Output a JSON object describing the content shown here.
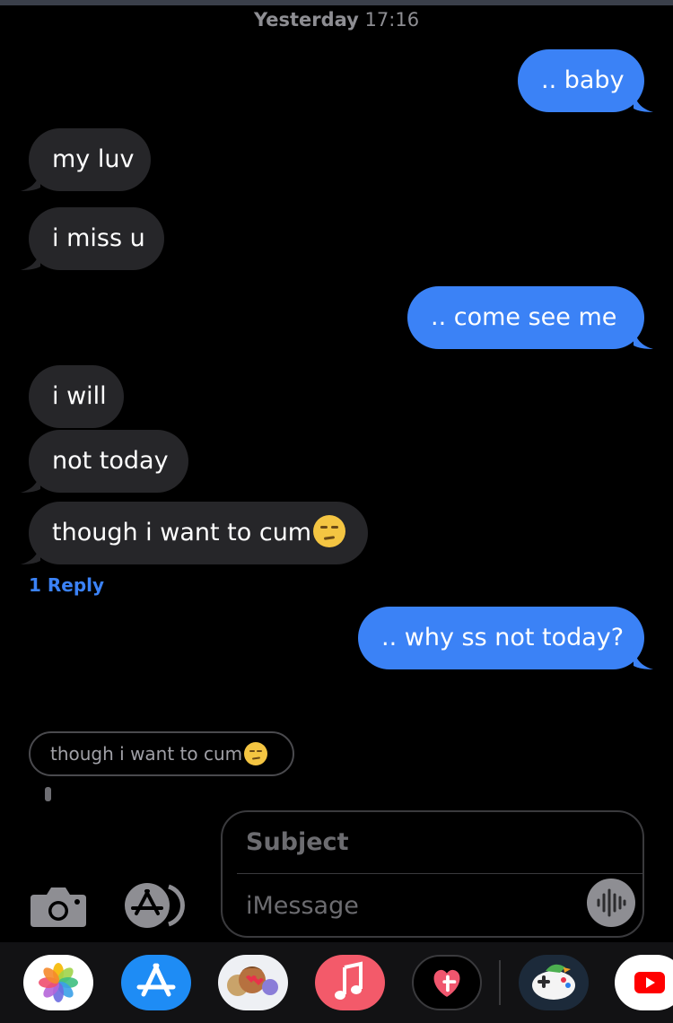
{
  "header": {
    "day": "Yesterday",
    "time": "17:16"
  },
  "messages": [
    {
      "text": ".. baby"
    },
    {
      "text": "my luv"
    },
    {
      "text": "i miss u"
    },
    {
      "text": ".. come see me"
    },
    {
      "text": "i will"
    },
    {
      "text": "not today"
    },
    {
      "text": "though i want to cum"
    },
    {
      "text": ".. why ss not today?"
    }
  ],
  "reply_link": "1 Reply",
  "quoted_reply": {
    "text": "though i want to cum"
  },
  "compose": {
    "subject_placeholder": "Subject",
    "message_placeholder": "iMessage"
  },
  "colors": {
    "outgoing": "#3b82f6",
    "incoming": "#262629",
    "background": "#000000"
  },
  "app_bar": [
    "photos-icon",
    "app-store-icon",
    "memoji-icon",
    "music-icon",
    "digital-touch-icon",
    "game-pigeon-icon",
    "youtube-icon"
  ]
}
